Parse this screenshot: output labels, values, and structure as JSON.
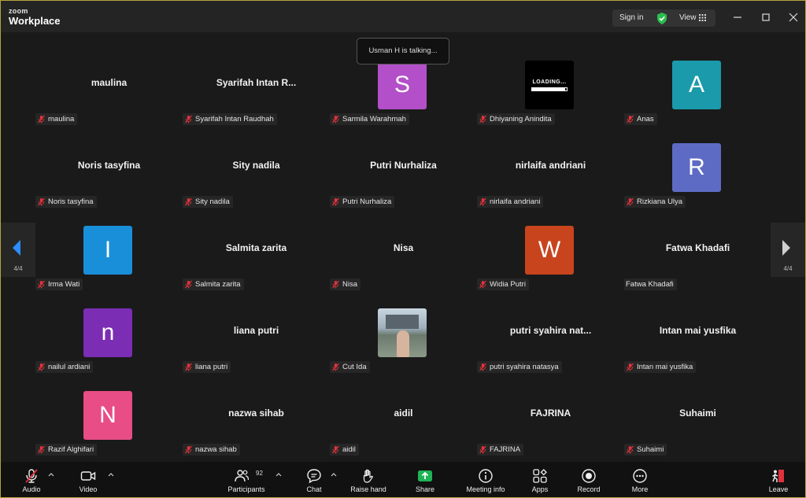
{
  "app": {
    "logo_line1": "zoom",
    "logo_line2": "Workplace",
    "sign_in": "Sign in",
    "view": "View"
  },
  "status": {
    "talking": "Usman H is talking..."
  },
  "pager": {
    "left": "4/4",
    "right": "4/4"
  },
  "tiles": [
    {
      "display": "maulina",
      "tag": "maulina"
    },
    {
      "display": "Syarifah Intan R...",
      "tag": "Syarifah Intan Raudhah"
    },
    {
      "avatar": "S",
      "color": "#b34fc8",
      "tag": "Sarmila Warahmah"
    },
    {
      "loading": "LOADING...",
      "loading_progress": 0.95,
      "tag": "Dhiyaning Anindita"
    },
    {
      "avatar": "A",
      "color": "#1a9aab",
      "tag": "Anas"
    },
    {
      "display": "Noris tasyfina",
      "tag": "Noris tasyfina"
    },
    {
      "display": "Sity nadila",
      "tag": "Sity nadila"
    },
    {
      "display": "Putri Nurhaliza",
      "tag": "Putri Nurhaliza"
    },
    {
      "display": "nirlaifa andriani",
      "tag": "nirlaifa andriani"
    },
    {
      "avatar": "R",
      "color": "#5d6bc4",
      "tag": "Rizkiana Ulya"
    },
    {
      "avatar": "I",
      "color": "#1a8fd9",
      "tag": "Irma Wati"
    },
    {
      "display": "Salmita zarita",
      "tag": "Salmita zarita"
    },
    {
      "display": "Nisa",
      "tag": "Nisa"
    },
    {
      "avatar": "W",
      "color": "#c8441c",
      "tag": "Widia Putri"
    },
    {
      "display": "Fatwa Khadafi",
      "tag": "Fatwa Khadafi",
      "nomic": true
    },
    {
      "avatar": "n",
      "color": "#7b2db3",
      "tag": "nailul ardiani"
    },
    {
      "display": "liana putri",
      "tag": "liana putri"
    },
    {
      "photo": true,
      "tag": "Cut Ida"
    },
    {
      "display": "putri syahira nat...",
      "tag": "putri syahira natasya"
    },
    {
      "display": "Intan mai yusfika",
      "tag": "Intan mai yusfika"
    },
    {
      "avatar": "N",
      "color": "#e84d85",
      "tag": "Razif Alghifari"
    },
    {
      "display": "nazwa sihab",
      "tag": "nazwa sihab"
    },
    {
      "display": "aidil",
      "tag": "aidil"
    },
    {
      "display": "FAJRINA",
      "tag": "FAJRINA"
    },
    {
      "display": "Suhaimi",
      "tag": "Suhaimi"
    }
  ],
  "toolbar": {
    "audio": "Audio",
    "video": "Video",
    "participants": "Participants",
    "participant_count": "92",
    "chat": "Chat",
    "raise_hand": "Raise hand",
    "share": "Share",
    "meeting_info": "Meeting info",
    "apps": "Apps",
    "record": "Record",
    "more": "More",
    "leave": "Leave"
  },
  "colors": {
    "share_green": "#1fb355",
    "leave_red": "#e0323c",
    "mute_red": "#e0323c",
    "shield_green": "#2bbd4e"
  }
}
